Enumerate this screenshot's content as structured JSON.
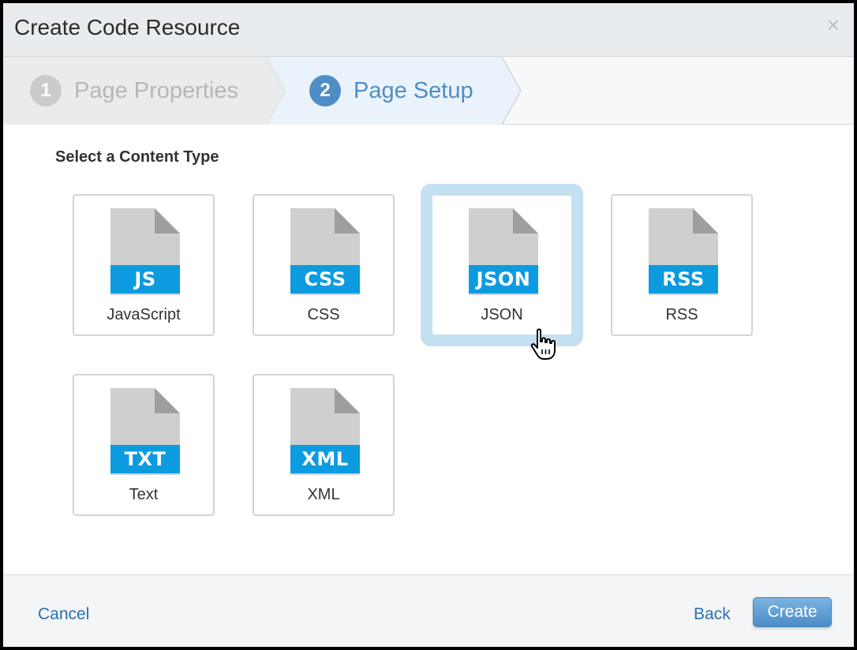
{
  "dialog": {
    "title": "Create Code Resource",
    "close_icon": "close-icon",
    "close_glyph": "×"
  },
  "steps": [
    {
      "number": "1",
      "label": "Page Properties",
      "state": "completed"
    },
    {
      "number": "2",
      "label": "Page Setup",
      "state": "active"
    }
  ],
  "content": {
    "section_label": "Select a Content Type",
    "selected": "JSON",
    "tiles": [
      {
        "badge": "JS",
        "label": "JavaScript"
      },
      {
        "badge": "CSS",
        "label": "CSS"
      },
      {
        "badge": "JSON",
        "label": "JSON"
      },
      {
        "badge": "RSS",
        "label": "RSS"
      },
      {
        "badge": "TXT",
        "label": "Text"
      },
      {
        "badge": "XML",
        "label": "XML"
      }
    ]
  },
  "footer": {
    "cancel_label": "Cancel",
    "back_label": "Back",
    "create_label": "Create"
  },
  "colors": {
    "accent": "#4f8dc6",
    "badge": "#0d9be0",
    "selection_ring": "#c5e0f1",
    "link": "#2d6fb3"
  }
}
